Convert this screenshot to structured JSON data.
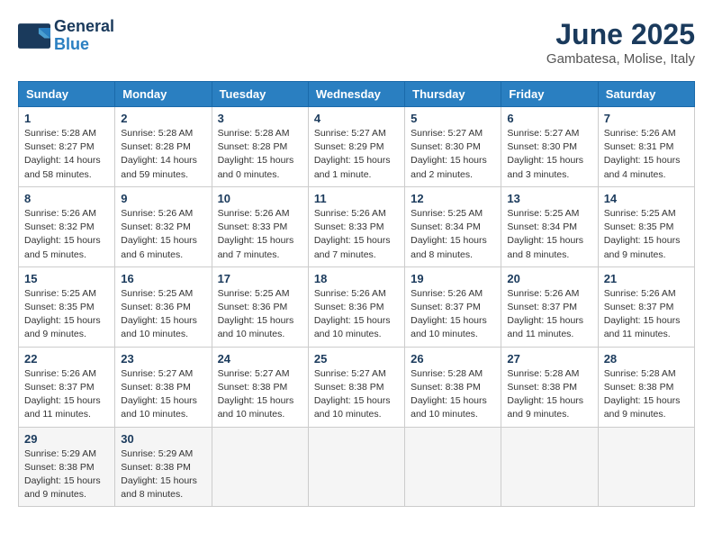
{
  "header": {
    "logo_line1": "General",
    "logo_line2": "Blue",
    "month_title": "June 2025",
    "location": "Gambatesa, Molise, Italy"
  },
  "days_of_week": [
    "Sunday",
    "Monday",
    "Tuesday",
    "Wednesday",
    "Thursday",
    "Friday",
    "Saturday"
  ],
  "weeks": [
    [
      {
        "day": 1,
        "info": "Sunrise: 5:28 AM\nSunset: 8:27 PM\nDaylight: 14 hours\nand 58 minutes."
      },
      {
        "day": 2,
        "info": "Sunrise: 5:28 AM\nSunset: 8:28 PM\nDaylight: 14 hours\nand 59 minutes."
      },
      {
        "day": 3,
        "info": "Sunrise: 5:28 AM\nSunset: 8:28 PM\nDaylight: 15 hours\nand 0 minutes."
      },
      {
        "day": 4,
        "info": "Sunrise: 5:27 AM\nSunset: 8:29 PM\nDaylight: 15 hours\nand 1 minute."
      },
      {
        "day": 5,
        "info": "Sunrise: 5:27 AM\nSunset: 8:30 PM\nDaylight: 15 hours\nand 2 minutes."
      },
      {
        "day": 6,
        "info": "Sunrise: 5:27 AM\nSunset: 8:30 PM\nDaylight: 15 hours\nand 3 minutes."
      },
      {
        "day": 7,
        "info": "Sunrise: 5:26 AM\nSunset: 8:31 PM\nDaylight: 15 hours\nand 4 minutes."
      }
    ],
    [
      {
        "day": 8,
        "info": "Sunrise: 5:26 AM\nSunset: 8:32 PM\nDaylight: 15 hours\nand 5 minutes."
      },
      {
        "day": 9,
        "info": "Sunrise: 5:26 AM\nSunset: 8:32 PM\nDaylight: 15 hours\nand 6 minutes."
      },
      {
        "day": 10,
        "info": "Sunrise: 5:26 AM\nSunset: 8:33 PM\nDaylight: 15 hours\nand 7 minutes."
      },
      {
        "day": 11,
        "info": "Sunrise: 5:26 AM\nSunset: 8:33 PM\nDaylight: 15 hours\nand 7 minutes."
      },
      {
        "day": 12,
        "info": "Sunrise: 5:25 AM\nSunset: 8:34 PM\nDaylight: 15 hours\nand 8 minutes."
      },
      {
        "day": 13,
        "info": "Sunrise: 5:25 AM\nSunset: 8:34 PM\nDaylight: 15 hours\nand 8 minutes."
      },
      {
        "day": 14,
        "info": "Sunrise: 5:25 AM\nSunset: 8:35 PM\nDaylight: 15 hours\nand 9 minutes."
      }
    ],
    [
      {
        "day": 15,
        "info": "Sunrise: 5:25 AM\nSunset: 8:35 PM\nDaylight: 15 hours\nand 9 minutes."
      },
      {
        "day": 16,
        "info": "Sunrise: 5:25 AM\nSunset: 8:36 PM\nDaylight: 15 hours\nand 10 minutes."
      },
      {
        "day": 17,
        "info": "Sunrise: 5:25 AM\nSunset: 8:36 PM\nDaylight: 15 hours\nand 10 minutes."
      },
      {
        "day": 18,
        "info": "Sunrise: 5:26 AM\nSunset: 8:36 PM\nDaylight: 15 hours\nand 10 minutes."
      },
      {
        "day": 19,
        "info": "Sunrise: 5:26 AM\nSunset: 8:37 PM\nDaylight: 15 hours\nand 10 minutes."
      },
      {
        "day": 20,
        "info": "Sunrise: 5:26 AM\nSunset: 8:37 PM\nDaylight: 15 hours\nand 11 minutes."
      },
      {
        "day": 21,
        "info": "Sunrise: 5:26 AM\nSunset: 8:37 PM\nDaylight: 15 hours\nand 11 minutes."
      }
    ],
    [
      {
        "day": 22,
        "info": "Sunrise: 5:26 AM\nSunset: 8:37 PM\nDaylight: 15 hours\nand 11 minutes."
      },
      {
        "day": 23,
        "info": "Sunrise: 5:27 AM\nSunset: 8:38 PM\nDaylight: 15 hours\nand 10 minutes."
      },
      {
        "day": 24,
        "info": "Sunrise: 5:27 AM\nSunset: 8:38 PM\nDaylight: 15 hours\nand 10 minutes."
      },
      {
        "day": 25,
        "info": "Sunrise: 5:27 AM\nSunset: 8:38 PM\nDaylight: 15 hours\nand 10 minutes."
      },
      {
        "day": 26,
        "info": "Sunrise: 5:28 AM\nSunset: 8:38 PM\nDaylight: 15 hours\nand 10 minutes."
      },
      {
        "day": 27,
        "info": "Sunrise: 5:28 AM\nSunset: 8:38 PM\nDaylight: 15 hours\nand 9 minutes."
      },
      {
        "day": 28,
        "info": "Sunrise: 5:28 AM\nSunset: 8:38 PM\nDaylight: 15 hours\nand 9 minutes."
      }
    ],
    [
      {
        "day": 29,
        "info": "Sunrise: 5:29 AM\nSunset: 8:38 PM\nDaylight: 15 hours\nand 9 minutes."
      },
      {
        "day": 30,
        "info": "Sunrise: 5:29 AM\nSunset: 8:38 PM\nDaylight: 15 hours\nand 8 minutes."
      },
      null,
      null,
      null,
      null,
      null
    ]
  ]
}
